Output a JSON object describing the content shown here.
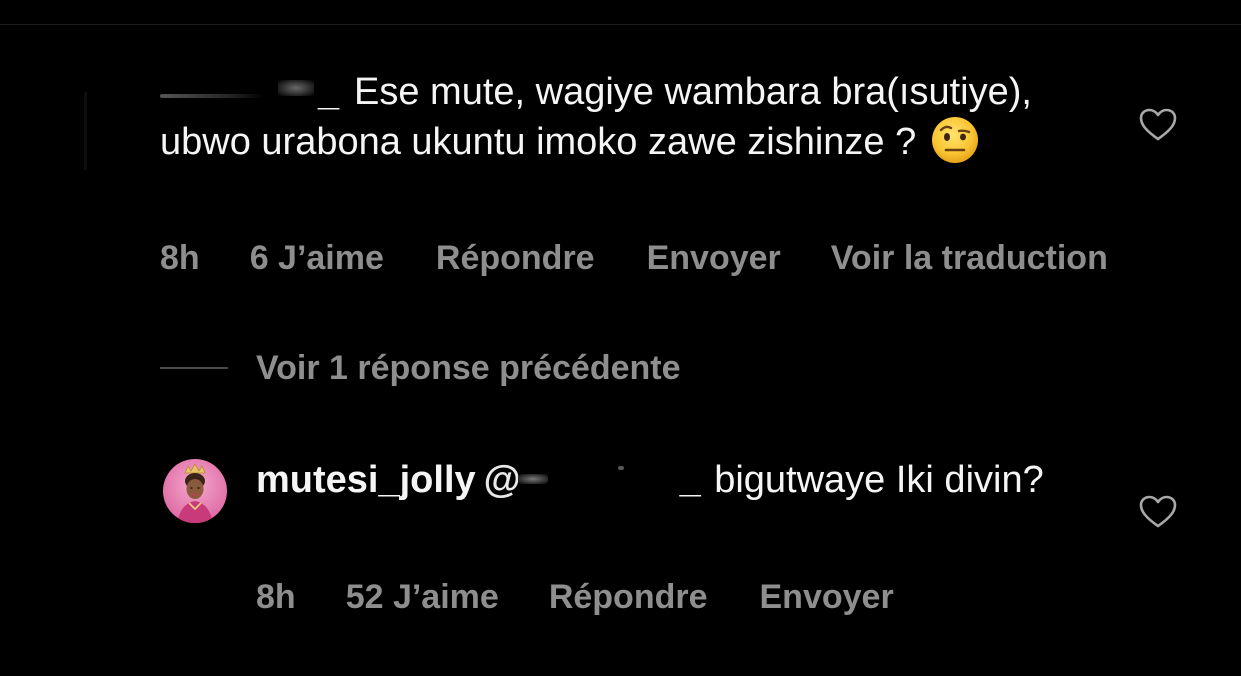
{
  "colors": {
    "background": "#000000",
    "primary_text": "#f5f5f5",
    "secondary_text": "#8e8e8e",
    "heart_outline": "#a8a8a8"
  },
  "icons": {
    "like": "heart-outline-icon",
    "emoji": "face-with-raised-eyebrow-emoji"
  },
  "comment": {
    "username_visible_suffix": "_",
    "text": "Ese mute, wagiye wambara bra(ısutiye), ubwo urabona ukuntu imoko zawe zishinze ?",
    "emoji": "🤨",
    "time": "8h",
    "likes": "6 J’aime",
    "reply_label": "Répondre",
    "send_label": "Envoyer",
    "translate_label": "Voir la traduction"
  },
  "view_replies": {
    "label": "Voir 1 réponse précédente"
  },
  "reply": {
    "username": "mutesi_jolly",
    "mention_visible_prefix": "@",
    "mention_visible_suffix": "_",
    "text": "bigutwaye Iki divin?",
    "time": "8h",
    "likes": "52 J’aime",
    "reply_label": "Répondre",
    "send_label": "Envoyer"
  }
}
